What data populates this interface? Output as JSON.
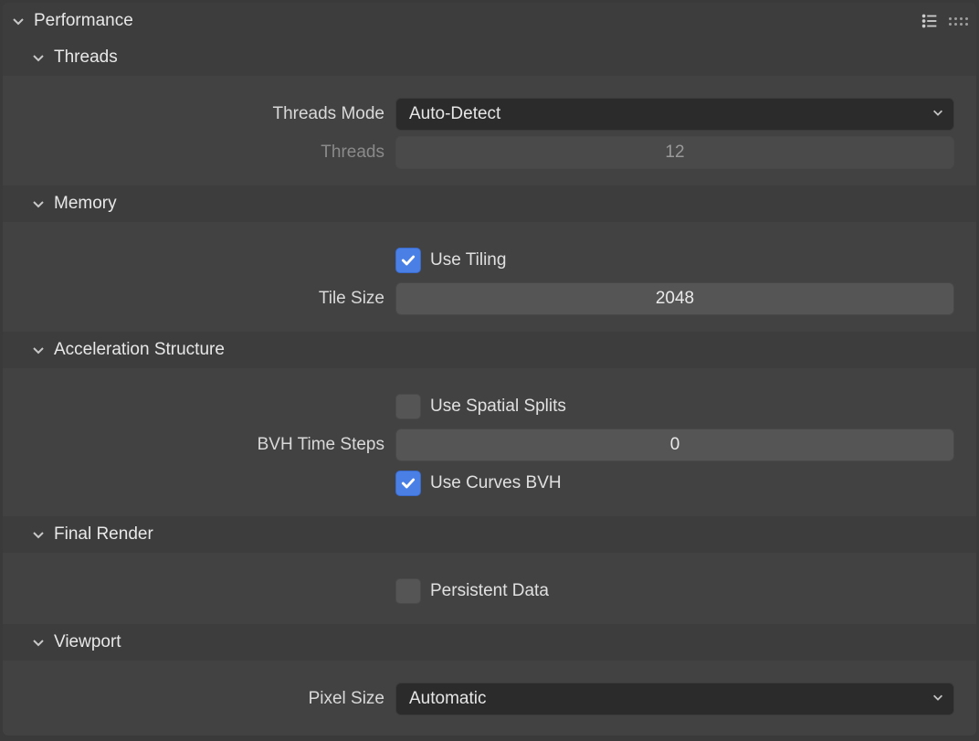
{
  "panel": {
    "title": "Performance"
  },
  "threads": {
    "title": "Threads",
    "mode_label": "Threads Mode",
    "mode_value": "Auto-Detect",
    "count_label": "Threads",
    "count_value": "12"
  },
  "memory": {
    "title": "Memory",
    "use_tiling_label": "Use Tiling",
    "use_tiling_checked": true,
    "tile_size_label": "Tile Size",
    "tile_size_value": "2048"
  },
  "accel": {
    "title": "Acceleration Structure",
    "use_spatial_splits_label": "Use Spatial Splits",
    "use_spatial_splits_checked": false,
    "bvh_time_steps_label": "BVH Time Steps",
    "bvh_time_steps_value": "0",
    "use_curves_bvh_label": "Use Curves BVH",
    "use_curves_bvh_checked": true
  },
  "final_render": {
    "title": "Final Render",
    "persistent_data_label": "Persistent Data",
    "persistent_data_checked": false
  },
  "viewport": {
    "title": "Viewport",
    "pixel_size_label": "Pixel Size",
    "pixel_size_value": "Automatic"
  }
}
